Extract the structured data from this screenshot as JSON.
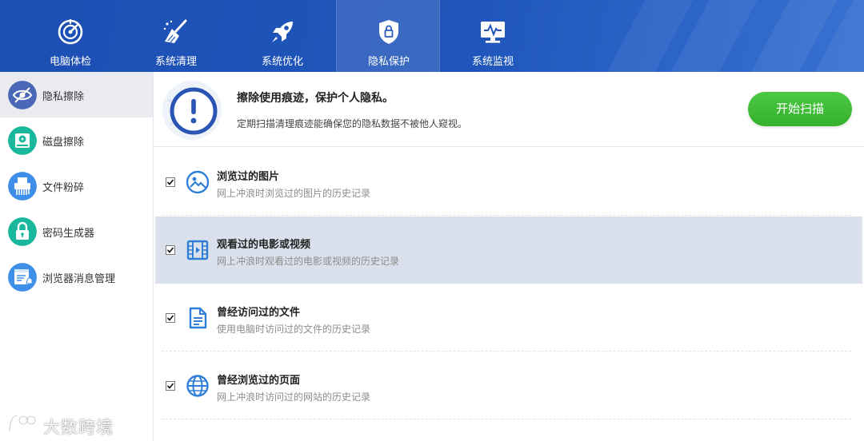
{
  "nav": {
    "tabs": [
      {
        "label": "电脑体检",
        "icon": "radar-icon",
        "active": false
      },
      {
        "label": "系统清理",
        "icon": "broom-icon",
        "active": false
      },
      {
        "label": "系统优化",
        "icon": "rocket-icon",
        "active": false
      },
      {
        "label": "隐私保护",
        "icon": "shield-lock-icon",
        "active": true
      },
      {
        "label": "系统监视",
        "icon": "monitor-pulse-icon",
        "active": false
      }
    ]
  },
  "sidebar": {
    "items": [
      {
        "label": "隐私擦除",
        "icon": "eye-hidden-icon",
        "color": "#4a67b8",
        "active": true
      },
      {
        "label": "磁盘擦除",
        "icon": "disk-icon",
        "color": "#19b79b",
        "active": false
      },
      {
        "label": "文件粉碎",
        "icon": "shredder-icon",
        "color": "#3d8fe8",
        "active": false
      },
      {
        "label": "密码生成器",
        "icon": "lock-icon",
        "color": "#19b79b",
        "active": false
      },
      {
        "label": "浏览器消息管理",
        "icon": "browser-bell-icon",
        "color": "#3d8fe8",
        "active": false
      }
    ]
  },
  "header": {
    "title": "擦除使用痕迹，保护个人隐私。",
    "subtitle": "定期扫描清理痕迹能确保您的隐私数据不被他人窥视。",
    "scan_button": "开始扫描",
    "icon": "exclamation-circle-icon"
  },
  "items": [
    {
      "title": "浏览过的图片",
      "desc": "网上冲浪时浏览过的图片的历史记录",
      "checked": true,
      "icon": "image-icon",
      "selected": false
    },
    {
      "title": "观看过的电影或视频",
      "desc": "网上冲浪时观看过的电影或视频的历史记录",
      "checked": true,
      "icon": "film-icon",
      "selected": true
    },
    {
      "title": "曾经访问过的文件",
      "desc": "使用电脑时访问过的文件的历史记录",
      "checked": true,
      "icon": "document-icon",
      "selected": false
    },
    {
      "title": "曾经浏览过的页面",
      "desc": "网上冲浪时访问过的网站的历史记录",
      "checked": true,
      "icon": "globe-icon",
      "selected": false
    }
  ],
  "watermark": {
    "text": "大数跨境"
  },
  "colors": {
    "nav_bg": "#1f54b8",
    "accent": "#2f7fd8",
    "button_green": "#3dbb35",
    "row_selected": "#dbe1ec"
  }
}
